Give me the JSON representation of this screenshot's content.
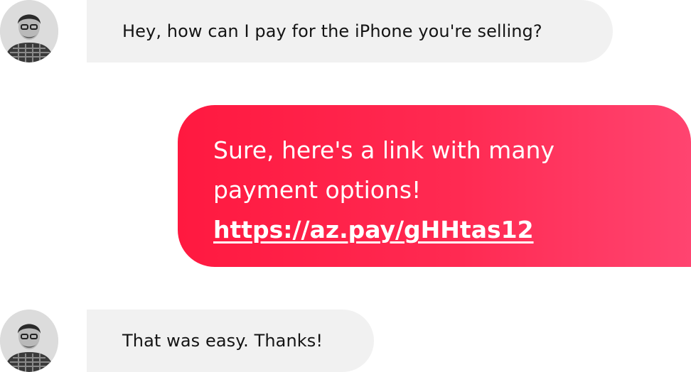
{
  "conversation": {
    "messages": [
      {
        "sender": "contact",
        "text": "Hey, how can I pay for the iPhone you're selling?"
      },
      {
        "sender": "me",
        "lines": [
          "Sure, here's a link with many",
          "payment options!"
        ],
        "link": "https://az.pay/gHHtas12"
      },
      {
        "sender": "contact",
        "text": "That was easy. Thanks!"
      }
    ]
  },
  "colors": {
    "incoming_bubble": "#f1f1f1",
    "outgoing_gradient_start": "#ff1940",
    "outgoing_gradient_end": "#ff4470",
    "outgoing_text": "#ffffff"
  }
}
